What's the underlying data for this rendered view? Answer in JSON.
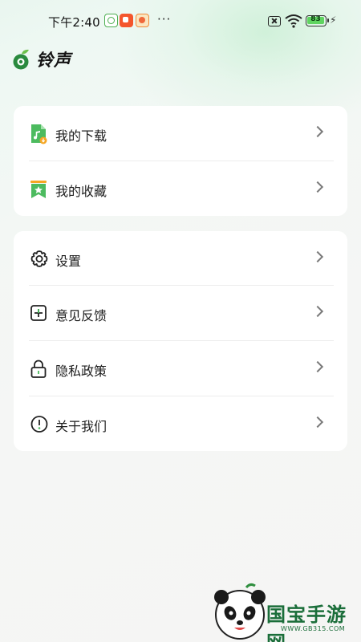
{
  "status_bar": {
    "time": "下午2:40",
    "dots": "···",
    "battery": "83",
    "notification_icons": [
      "camera-app-icon",
      "red-app-icon",
      "orange-app-icon"
    ]
  },
  "header": {
    "title": "铃声"
  },
  "card1": {
    "items": [
      {
        "label": "我的下载",
        "icon": "download-music-icon"
      },
      {
        "label": "我的收藏",
        "icon": "bookmark-star-icon"
      }
    ]
  },
  "card2": {
    "items": [
      {
        "label": "设置",
        "icon": "gear-icon"
      },
      {
        "label": "意见反馈",
        "icon": "plus-square-icon"
      },
      {
        "label": "隐私政策",
        "icon": "lock-icon"
      },
      {
        "label": "关于我们",
        "icon": "info-circle-icon"
      }
    ]
  },
  "watermark": {
    "text": "国宝手游网",
    "url": "WWW.GB315.COM"
  },
  "colors": {
    "accent": "#4caf50",
    "text": "#1d1d1d",
    "chevron": "#7a7a7a",
    "background": "#f5f5f4"
  }
}
